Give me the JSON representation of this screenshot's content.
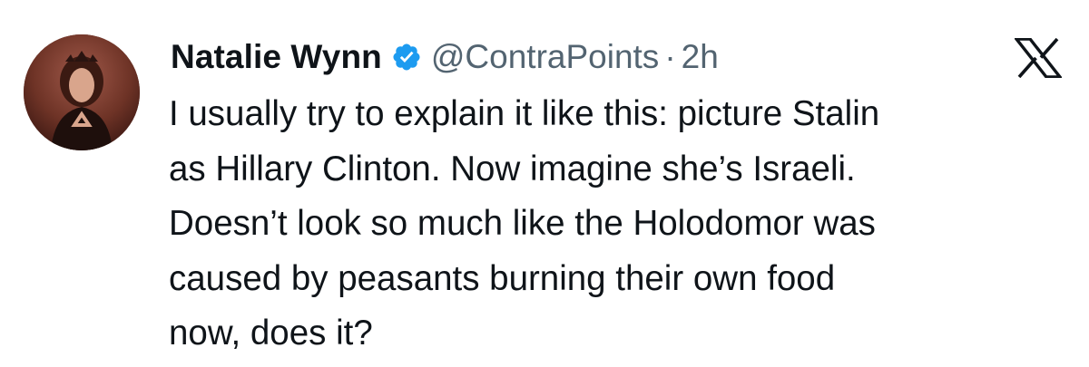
{
  "tweet": {
    "author": {
      "display_name": "Natalie Wynn",
      "handle": "@ContraPoints",
      "verified": true,
      "avatar_icon": "profile-photo"
    },
    "separator": "·",
    "timestamp": "2h",
    "platform_icon": "x-logo-icon",
    "text_lines": [
      "I usually try to explain it like this: picture Stalin",
      "as Hillary Clinton. Now imagine she’s Israeli.",
      "Doesn’t look so much like the Holodomor was",
      "caused by peasants burning their own food",
      "now, does it?"
    ]
  },
  "colors": {
    "verified_badge": "#1d9bf0",
    "secondary_text": "#536471",
    "primary_text": "#0f1419"
  }
}
